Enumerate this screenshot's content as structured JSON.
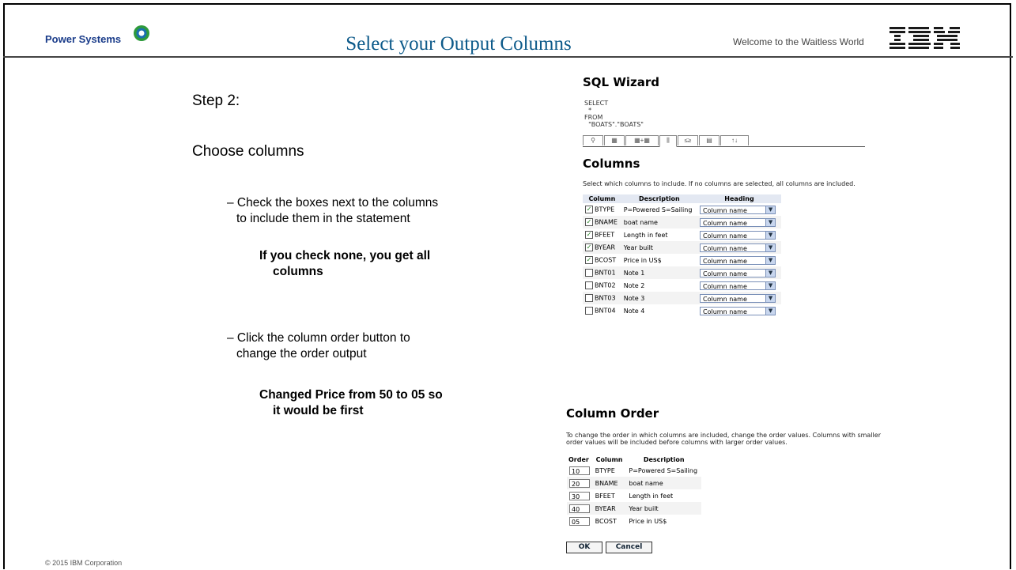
{
  "header": {
    "brand": "Power Systems",
    "title": "Select your Output Columns",
    "tagline": "Welcome to the Waitless World",
    "ibm_logo": "IBM"
  },
  "left": {
    "step": "Step 2:",
    "choose": "Choose columns",
    "bullet1_line1": "– Check the boxes next to the columns",
    "bullet1_line2": "to include them in the statement",
    "note1_line1": "If you check none, you get all",
    "note1_line2": "columns",
    "bullet2_line1": "– Click the column order button to",
    "bullet2_line2": "change the order output",
    "note2_line1": "Changed Price from 50 to 05 so",
    "note2_line2": "it would be first"
  },
  "wizard": {
    "title": "SQL Wizard",
    "sql_text": "SELECT\n  *\nFROM\n  \"BOATS\".\"BOATS\"",
    "tabs": [
      "⚲",
      "▦",
      "▦+▦",
      "⫼",
      "≤≥",
      "▤",
      "↑↓"
    ],
    "columns_heading": "Columns",
    "columns_desc": "Select which columns to include. If no columns are selected, all columns are included.",
    "col_headers": [
      "Column",
      "Description",
      "Heading"
    ],
    "rows": [
      {
        "name": "BTYPE",
        "desc": "P=Powered S=Sailing",
        "heading": "Column name",
        "checked": true
      },
      {
        "name": "BNAME",
        "desc": "boat name",
        "heading": "Column name",
        "checked": true
      },
      {
        "name": "BFEET",
        "desc": "Length in feet",
        "heading": "Column name",
        "checked": true
      },
      {
        "name": "BYEAR",
        "desc": "Year built",
        "heading": "Column name",
        "checked": true
      },
      {
        "name": "BCOST",
        "desc": "Price in US$",
        "heading": "Column name",
        "checked": true
      },
      {
        "name": "BNT01",
        "desc": "Note 1",
        "heading": "Column name",
        "checked": false
      },
      {
        "name": "BNT02",
        "desc": "Note 2",
        "heading": "Column name",
        "checked": false
      },
      {
        "name": "BNT03",
        "desc": "Note 3",
        "heading": "Column name",
        "checked": false
      },
      {
        "name": "BNT04",
        "desc": "Note 4",
        "heading": "Column name",
        "checked": false
      }
    ]
  },
  "order": {
    "heading": "Column Order",
    "desc": "To change the order in which columns are included, change the order values. Columns with smaller order values will be included before columns with larger order values.",
    "headers": [
      "Order",
      "Column",
      "Description"
    ],
    "rows": [
      {
        "order": "10",
        "column": "BTYPE",
        "desc": "P=Powered S=Sailing"
      },
      {
        "order": "20",
        "column": "BNAME",
        "desc": "boat name"
      },
      {
        "order": "30",
        "column": "BFEET",
        "desc": "Length in feet"
      },
      {
        "order": "40",
        "column": "BYEAR",
        "desc": "Year built"
      },
      {
        "order": "05",
        "column": "BCOST",
        "desc": "Price in US$"
      }
    ],
    "ok_label": "OK",
    "cancel_label": "Cancel"
  },
  "footer": {
    "copyright": "© 2015 IBM Corporation"
  }
}
